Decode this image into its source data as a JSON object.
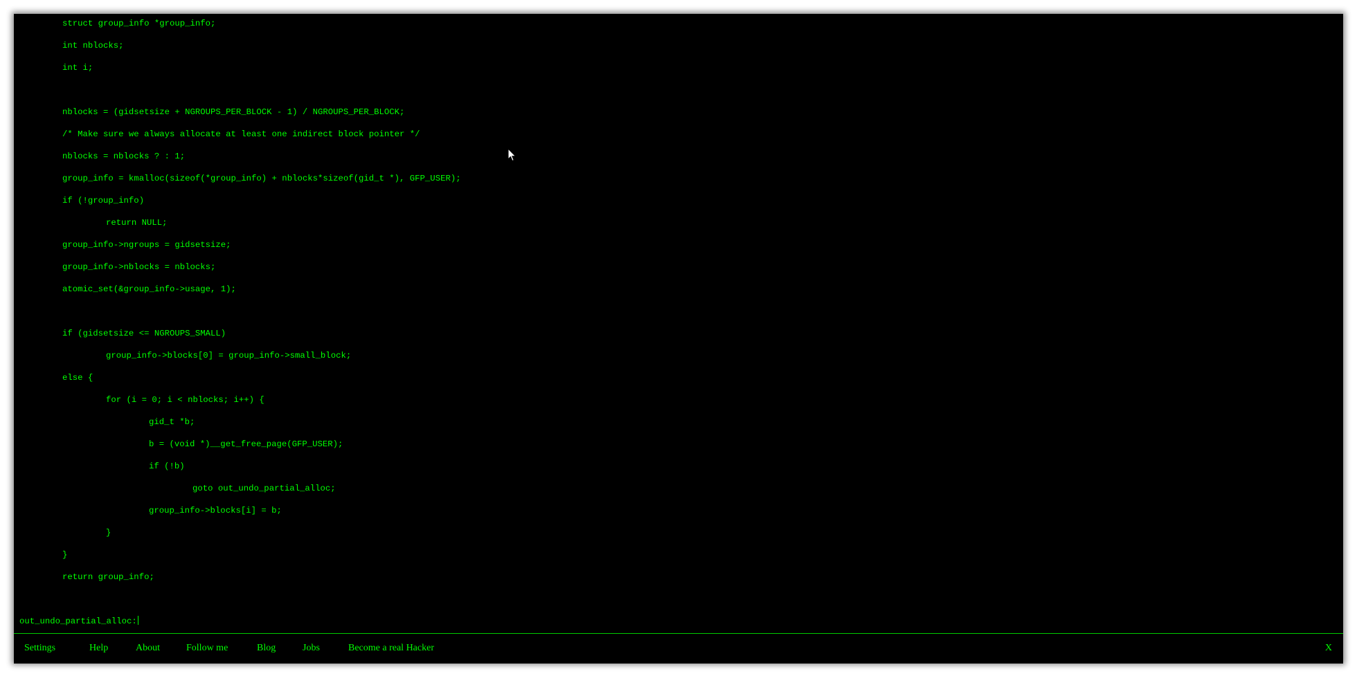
{
  "editor": {
    "lines": [
      "struct group_info *group_info;",
      "int nblocks;",
      "int i;",
      "",
      "nblocks = (gidsetsize + NGROUPS_PER_BLOCK - 1) / NGROUPS_PER_BLOCK;",
      "/* Make sure we always allocate at least one indirect block pointer */",
      "nblocks = nblocks ? : 1;",
      "group_info = kmalloc(sizeof(*group_info) + nblocks*sizeof(gid_t *), GFP_USER);",
      "if (!group_info)",
      "return NULL;",
      "group_info->ngroups = gidsetsize;",
      "group_info->nblocks = nblocks;",
      "atomic_set(&group_info->usage, 1);",
      "",
      "if (gidsetsize <= NGROUPS_SMALL)",
      "group_info->blocks[0] = group_info->small_block;",
      "else {",
      "for (i = 0; i < nblocks; i++) {",
      "gid_t *b;",
      "b = (void *)__get_free_page(GFP_USER);",
      "if (!b)",
      "goto out_undo_partial_alloc;",
      "group_info->blocks[i] = b;",
      "}",
      "}",
      "return group_info;",
      "",
      "out_undo_partial_alloc:"
    ]
  },
  "menu": {
    "settings": "Settings",
    "help": "Help",
    "about": "About",
    "follow": "Follow me",
    "blog": "Blog",
    "jobs": "Jobs",
    "hacker": "Become a real Hacker",
    "close": "X"
  },
  "colors": {
    "background": "#000000",
    "text": "#00ff00"
  }
}
